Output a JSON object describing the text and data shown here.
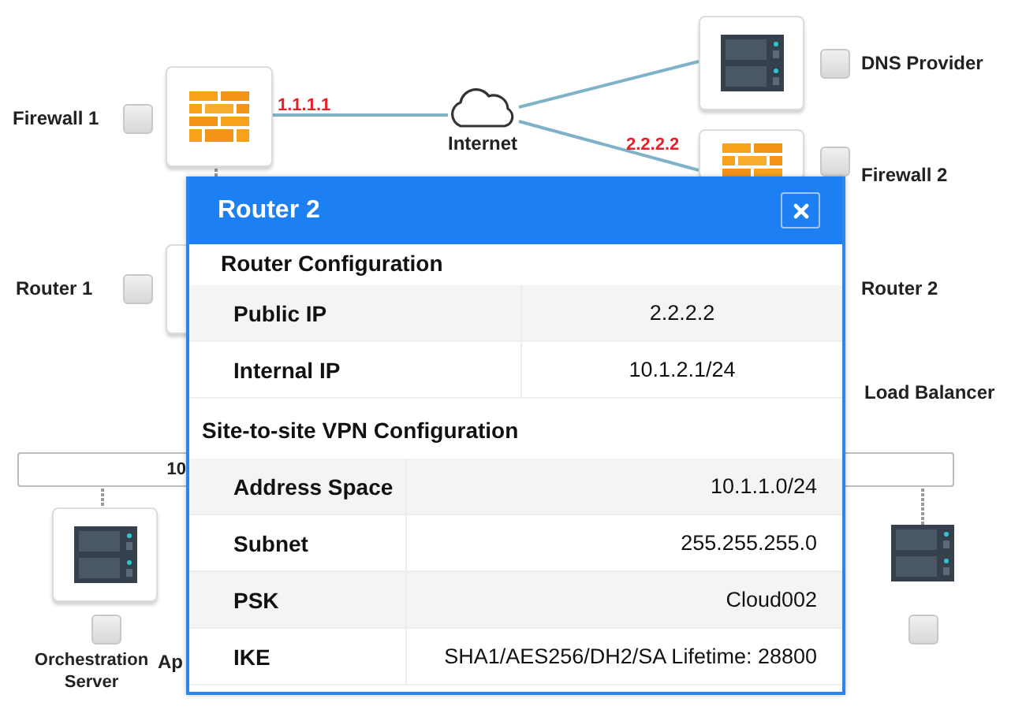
{
  "diagram": {
    "nodes": [
      {
        "kind": "firewall",
        "label": "Firewall 1",
        "checked": false
      },
      {
        "kind": "router",
        "label": "Router 1",
        "checked": false
      },
      {
        "kind": "cloud",
        "label": "Internet"
      },
      {
        "kind": "server",
        "label": "DNS Provider",
        "checked": false
      },
      {
        "kind": "firewall",
        "label": "Firewall 2",
        "checked": false
      },
      {
        "label": "Router 2"
      },
      {
        "label": "Load Balancer"
      },
      {
        "kind": "server",
        "label": "Orchestration Server",
        "checked": false
      },
      {
        "label": "Ap"
      },
      {
        "kind": "server",
        "checked": false
      }
    ],
    "link_labels": [
      "1.1.1.1",
      "2.2.2.2"
    ],
    "subnet_label": "10"
  },
  "dialog": {
    "title": "Router 2",
    "sections": [
      {
        "title": "Router Configuration",
        "rows": [
          {
            "key": "Public IP",
            "value": "2.2.2.2"
          },
          {
            "key": "Internal IP",
            "value": "10.1.2.1/24"
          }
        ]
      },
      {
        "title": "Site-to-site VPN Configuration",
        "rows": [
          {
            "key": "Address Space",
            "value": "10.1.1.0/24"
          },
          {
            "key": "Subnet",
            "value": "255.255.255.0"
          },
          {
            "key": "PSK",
            "value": "Cloud002"
          },
          {
            "key": "IKE",
            "value": "SHA1/AES256/DH2/SA Lifetime: 28800"
          }
        ]
      }
    ]
  }
}
